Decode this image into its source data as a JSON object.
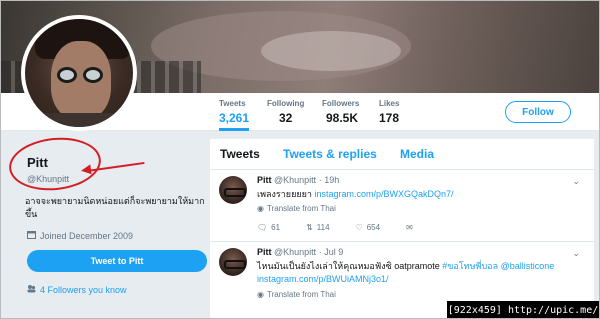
{
  "nav": {
    "stats": [
      {
        "label": "Tweets",
        "value": "3,261"
      },
      {
        "label": "Following",
        "value": "32"
      },
      {
        "label": "Followers",
        "value": "98.5K"
      },
      {
        "label": "Likes",
        "value": "178"
      }
    ],
    "follow_label": "Follow"
  },
  "profile": {
    "name": "Pitt",
    "handle": "@Khunpitt",
    "bio": "อาจจะพยายามนิดหน่อยแต่ก็จะพยายามให้มากขึ้น",
    "joined": "Joined December 2009",
    "tweet_to_label": "Tweet to Pitt",
    "followers_you_know": "4 Followers you know"
  },
  "timeline": {
    "tabs": [
      "Tweets",
      "Tweets & replies",
      "Media"
    ],
    "tweets": [
      {
        "name": "Pitt",
        "handle": "@Khunpitt",
        "time": "· 19h",
        "text": "เพลงรายยยยา ",
        "link": "instagram.com/p/BWXGQakDQn7/",
        "translate": "Translate from Thai",
        "replies": "61",
        "retweets": "114",
        "likes": "654"
      },
      {
        "name": "Pitt",
        "handle": "@Khunpitt",
        "time": "· Jul 9",
        "text": "ไหนมันเป็นยังไงเล่าให้คุณหมอฟังซิ oatpramote ",
        "hashtag": "#ขอโทษพี่บอล",
        "mention": " @ballisticone",
        "link": "instagram.com/p/BWUiAMNj3o1/",
        "translate": "Translate from Thai"
      }
    ]
  },
  "watermark": "[922x459] http://upic.me/",
  "colors": {
    "accent": "#1da1f2",
    "annotation": "#d21f26"
  }
}
